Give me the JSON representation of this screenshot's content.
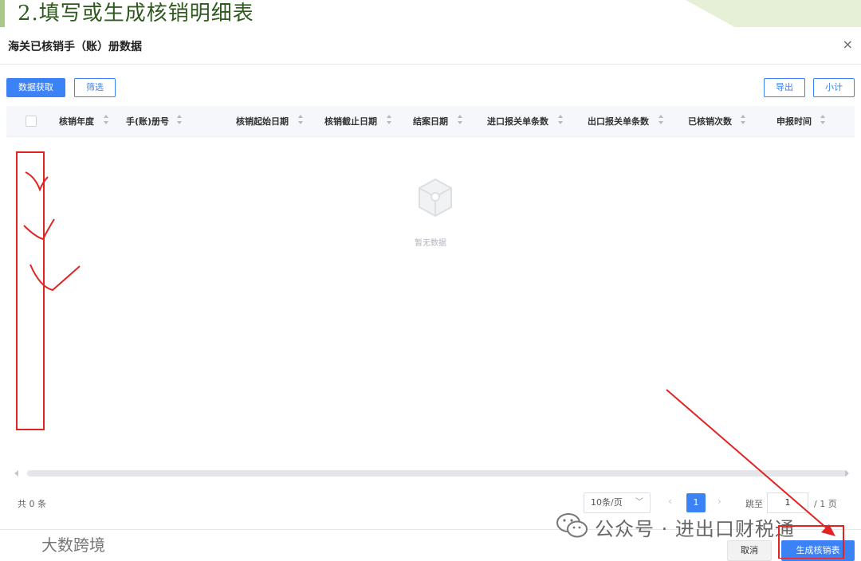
{
  "slide": {
    "title": "2.填写或生成核销明细表"
  },
  "dialog": {
    "title": "海关已核销手（账）册数据",
    "close_glyph": "×"
  },
  "toolbar": {
    "fetch_label": "数据获取",
    "filter_label": "筛选",
    "export_label": "导出",
    "subtotal_label": "小计"
  },
  "table": {
    "columns": [
      "核销年度",
      "手(账)册号",
      "核销起始日期",
      "核销截止日期",
      "结案日期",
      "进口报关单条数",
      "出口报关单条数",
      "已核销次数",
      "申报时间"
    ],
    "empty_text": "暂无数据"
  },
  "pagination": {
    "total": "共 0 条",
    "page_size": "10条/页",
    "current_page": "1",
    "jump_label": "跳至",
    "jump_value": "1",
    "page_total": "/ 1 页"
  },
  "footer": {
    "cancel_label": "取消",
    "generate_label": "生成核销表"
  },
  "watermark": {
    "text": "公众号 · 进出口财税通",
    "logo_text": "大数跨境"
  },
  "colors": {
    "primary": "#3b82f6",
    "annotation": "#e02424",
    "slide_accent": "#2f5a1e"
  },
  "icons": {
    "empty": "empty-box-icon",
    "close": "close-icon",
    "sort": "sort-icon",
    "wechat": "wechat-icon"
  }
}
